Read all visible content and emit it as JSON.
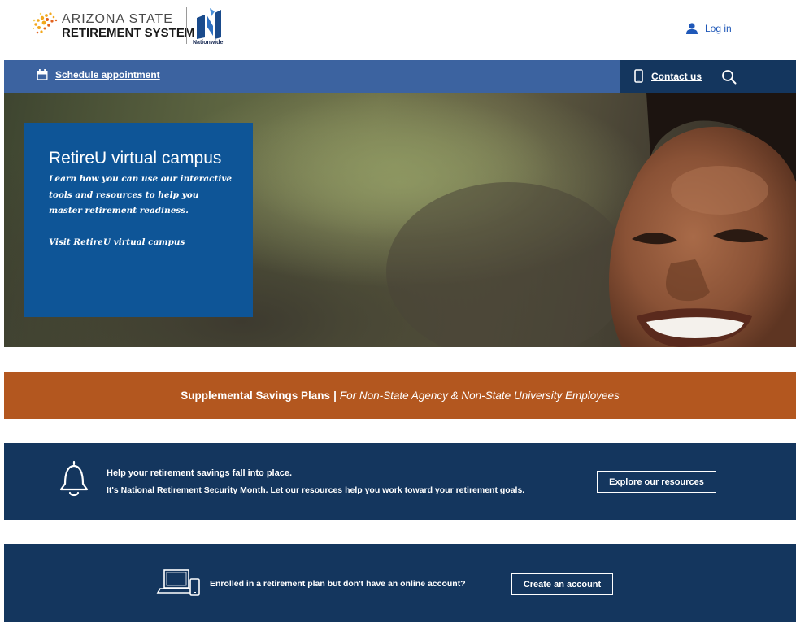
{
  "header": {
    "logo": {
      "line1": "ARIZONA STATE",
      "line2": "RETIREMENT SYSTEM",
      "partner": "Nationwide"
    },
    "login_label": "Log in"
  },
  "nav": {
    "schedule_label": "Schedule appointment",
    "contact_label": "Contact us"
  },
  "hero": {
    "title": "RetireU virtual campus",
    "body": "Learn how you can use our interactive tools and resources to help you master retirement readiness.",
    "link": "Visit RetireU virtual campus"
  },
  "ssp_banner": {
    "strong": "Supplemental Savings Plans",
    "separator": "|",
    "italic": "For Non-State Agency & Non-State University Employees"
  },
  "nrsm_banner": {
    "title": "Help your retirement savings fall into place.",
    "body_prefix": "It's National Retirement Security Month.",
    "body_link": "Let our resources help you",
    "body_suffix": "work toward your retirement goals.",
    "button_label": "Explore our resources"
  },
  "account_banner": {
    "text": "Enrolled in a retirement plan but don't have an online account?",
    "button_label": "Create an account"
  },
  "icons": {
    "logo": "asrs-sun-logo",
    "partner": "nationwide-logo",
    "user": "user-icon",
    "calendar": "calendar-icon",
    "phone": "mobile-phone-icon",
    "search": "search-icon",
    "bell": "bell-icon",
    "devices": "devices-icon"
  },
  "colors": {
    "nav_blue": "#3c63a0",
    "navy": "#14365e",
    "hero_card": "#0e5597",
    "orange": "#b3571f",
    "link_blue": "#1f58b8"
  }
}
